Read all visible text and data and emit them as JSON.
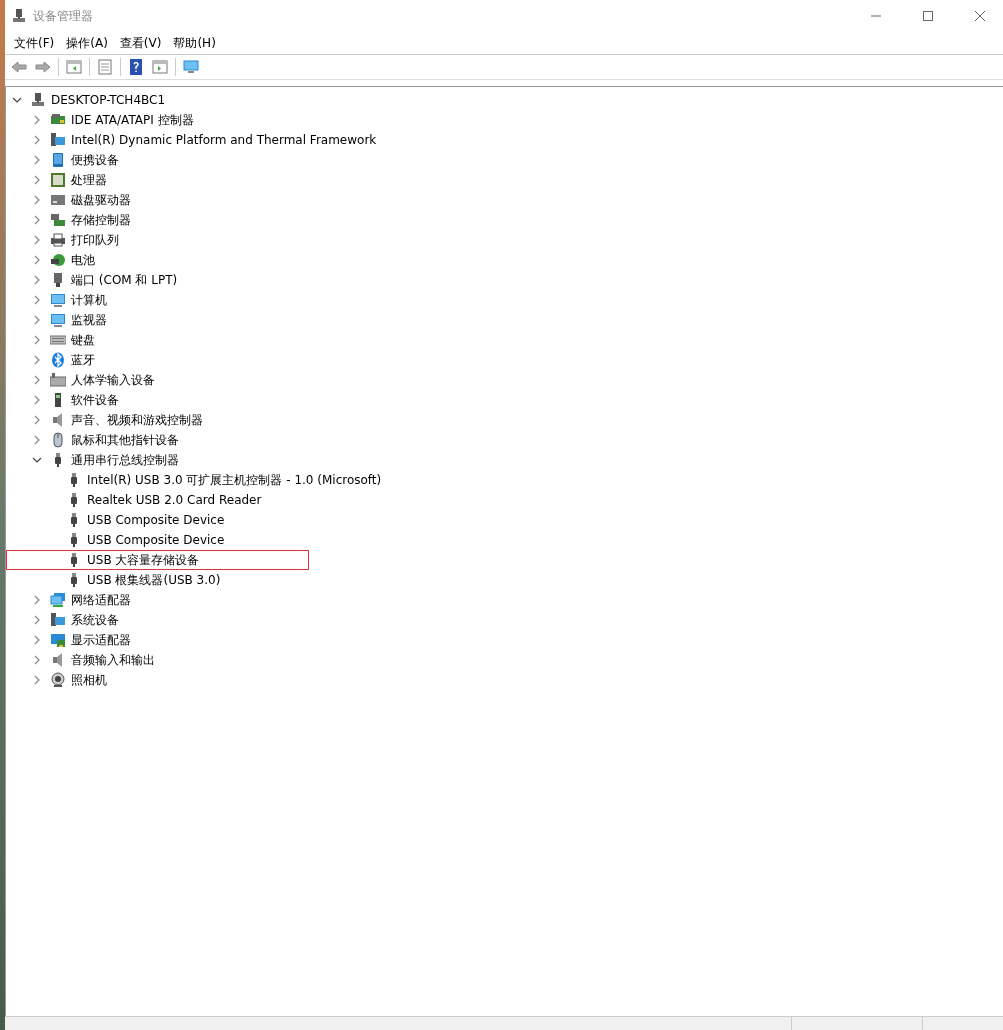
{
  "window": {
    "title": "设备管理器"
  },
  "menu": [
    "文件(F)",
    "操作(A)",
    "查看(V)",
    "帮助(H)"
  ],
  "tree": {
    "label": "DESKTOP-TCH4BC1",
    "kind": "computer",
    "expanded": true,
    "children": [
      {
        "label": "IDE ATA/ATAPI 控制器",
        "kind": "card",
        "expanded": false
      },
      {
        "label": "Intel(R) Dynamic Platform and Thermal Framework",
        "kind": "system",
        "expanded": false
      },
      {
        "label": "便携设备",
        "kind": "phone",
        "expanded": false
      },
      {
        "label": "处理器",
        "kind": "cpu",
        "expanded": false
      },
      {
        "label": "磁盘驱动器",
        "kind": "disk",
        "expanded": false
      },
      {
        "label": "存储控制器",
        "kind": "storage",
        "expanded": false
      },
      {
        "label": "打印队列",
        "kind": "printer",
        "expanded": false
      },
      {
        "label": "电池",
        "kind": "battery",
        "expanded": false
      },
      {
        "label": "端口 (COM 和 LPT)",
        "kind": "port",
        "expanded": false
      },
      {
        "label": "计算机",
        "kind": "monitor",
        "expanded": false
      },
      {
        "label": "监视器",
        "kind": "monitor",
        "expanded": false
      },
      {
        "label": "键盘",
        "kind": "keyboard",
        "expanded": false
      },
      {
        "label": "蓝牙",
        "kind": "bluetooth",
        "expanded": false
      },
      {
        "label": "人体学输入设备",
        "kind": "hid",
        "expanded": false
      },
      {
        "label": "软件设备",
        "kind": "software",
        "expanded": false
      },
      {
        "label": "声音、视频和游戏控制器",
        "kind": "speaker",
        "expanded": false
      },
      {
        "label": "鼠标和其他指针设备",
        "kind": "mouse",
        "expanded": false
      },
      {
        "label": "通用串行总线控制器",
        "kind": "usb",
        "expanded": true,
        "children": [
          {
            "label": "Intel(R) USB 3.0 可扩展主机控制器 - 1.0 (Microsoft)",
            "kind": "usb",
            "highlighted": false
          },
          {
            "label": "Realtek USB 2.0 Card Reader",
            "kind": "usb",
            "highlighted": false
          },
          {
            "label": "USB Composite Device",
            "kind": "usb",
            "highlighted": false
          },
          {
            "label": "USB Composite Device",
            "kind": "usb",
            "highlighted": false
          },
          {
            "label": "USB 大容量存储设备",
            "kind": "usb",
            "highlighted": true
          },
          {
            "label": "USB 根集线器(USB 3.0)",
            "kind": "usb",
            "highlighted": false
          }
        ]
      },
      {
        "label": "网络适配器",
        "kind": "network",
        "expanded": false
      },
      {
        "label": "系统设备",
        "kind": "system",
        "expanded": false
      },
      {
        "label": "显示适配器",
        "kind": "display",
        "expanded": false
      },
      {
        "label": "音频输入和输出",
        "kind": "speaker",
        "expanded": false
      },
      {
        "label": "照相机",
        "kind": "camera",
        "expanded": false
      }
    ]
  }
}
